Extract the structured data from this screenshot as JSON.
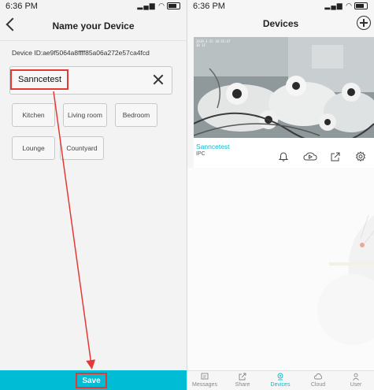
{
  "left_screen": {
    "status_time": "6:36 PM",
    "title": "Name your Device",
    "device_id": "Device ID:ae9f5064a8ffff85a06a272e57ca4fcd",
    "name_input_value": "Sanncetest",
    "room_chips": [
      "Kitchen",
      "Living room",
      "Bedroom",
      "Lounge",
      "Countyard"
    ],
    "save_label": "Save"
  },
  "right_screen": {
    "status_time": "6:36 PM",
    "title": "Devices",
    "camera_overlay": "2019-3-25  18:35:47",
    "camera_overlay_sub": "3D 1F",
    "device": {
      "name": "Sanncetest",
      "type": "IPC"
    },
    "device_actions": [
      "bell-icon",
      "cloud-play-icon",
      "share-icon",
      "settings-icon"
    ],
    "tabs": [
      {
        "label": "Messages",
        "icon": "messages-icon",
        "active": false
      },
      {
        "label": "Share",
        "icon": "share-icon",
        "active": false
      },
      {
        "label": "Devices",
        "icon": "devices-icon",
        "active": true
      },
      {
        "label": "Cloud",
        "icon": "cloud-icon",
        "active": false
      },
      {
        "label": "User",
        "icon": "user-icon",
        "active": false
      }
    ]
  },
  "colors": {
    "accent": "#00bcd4",
    "highlight": "#e53935"
  }
}
